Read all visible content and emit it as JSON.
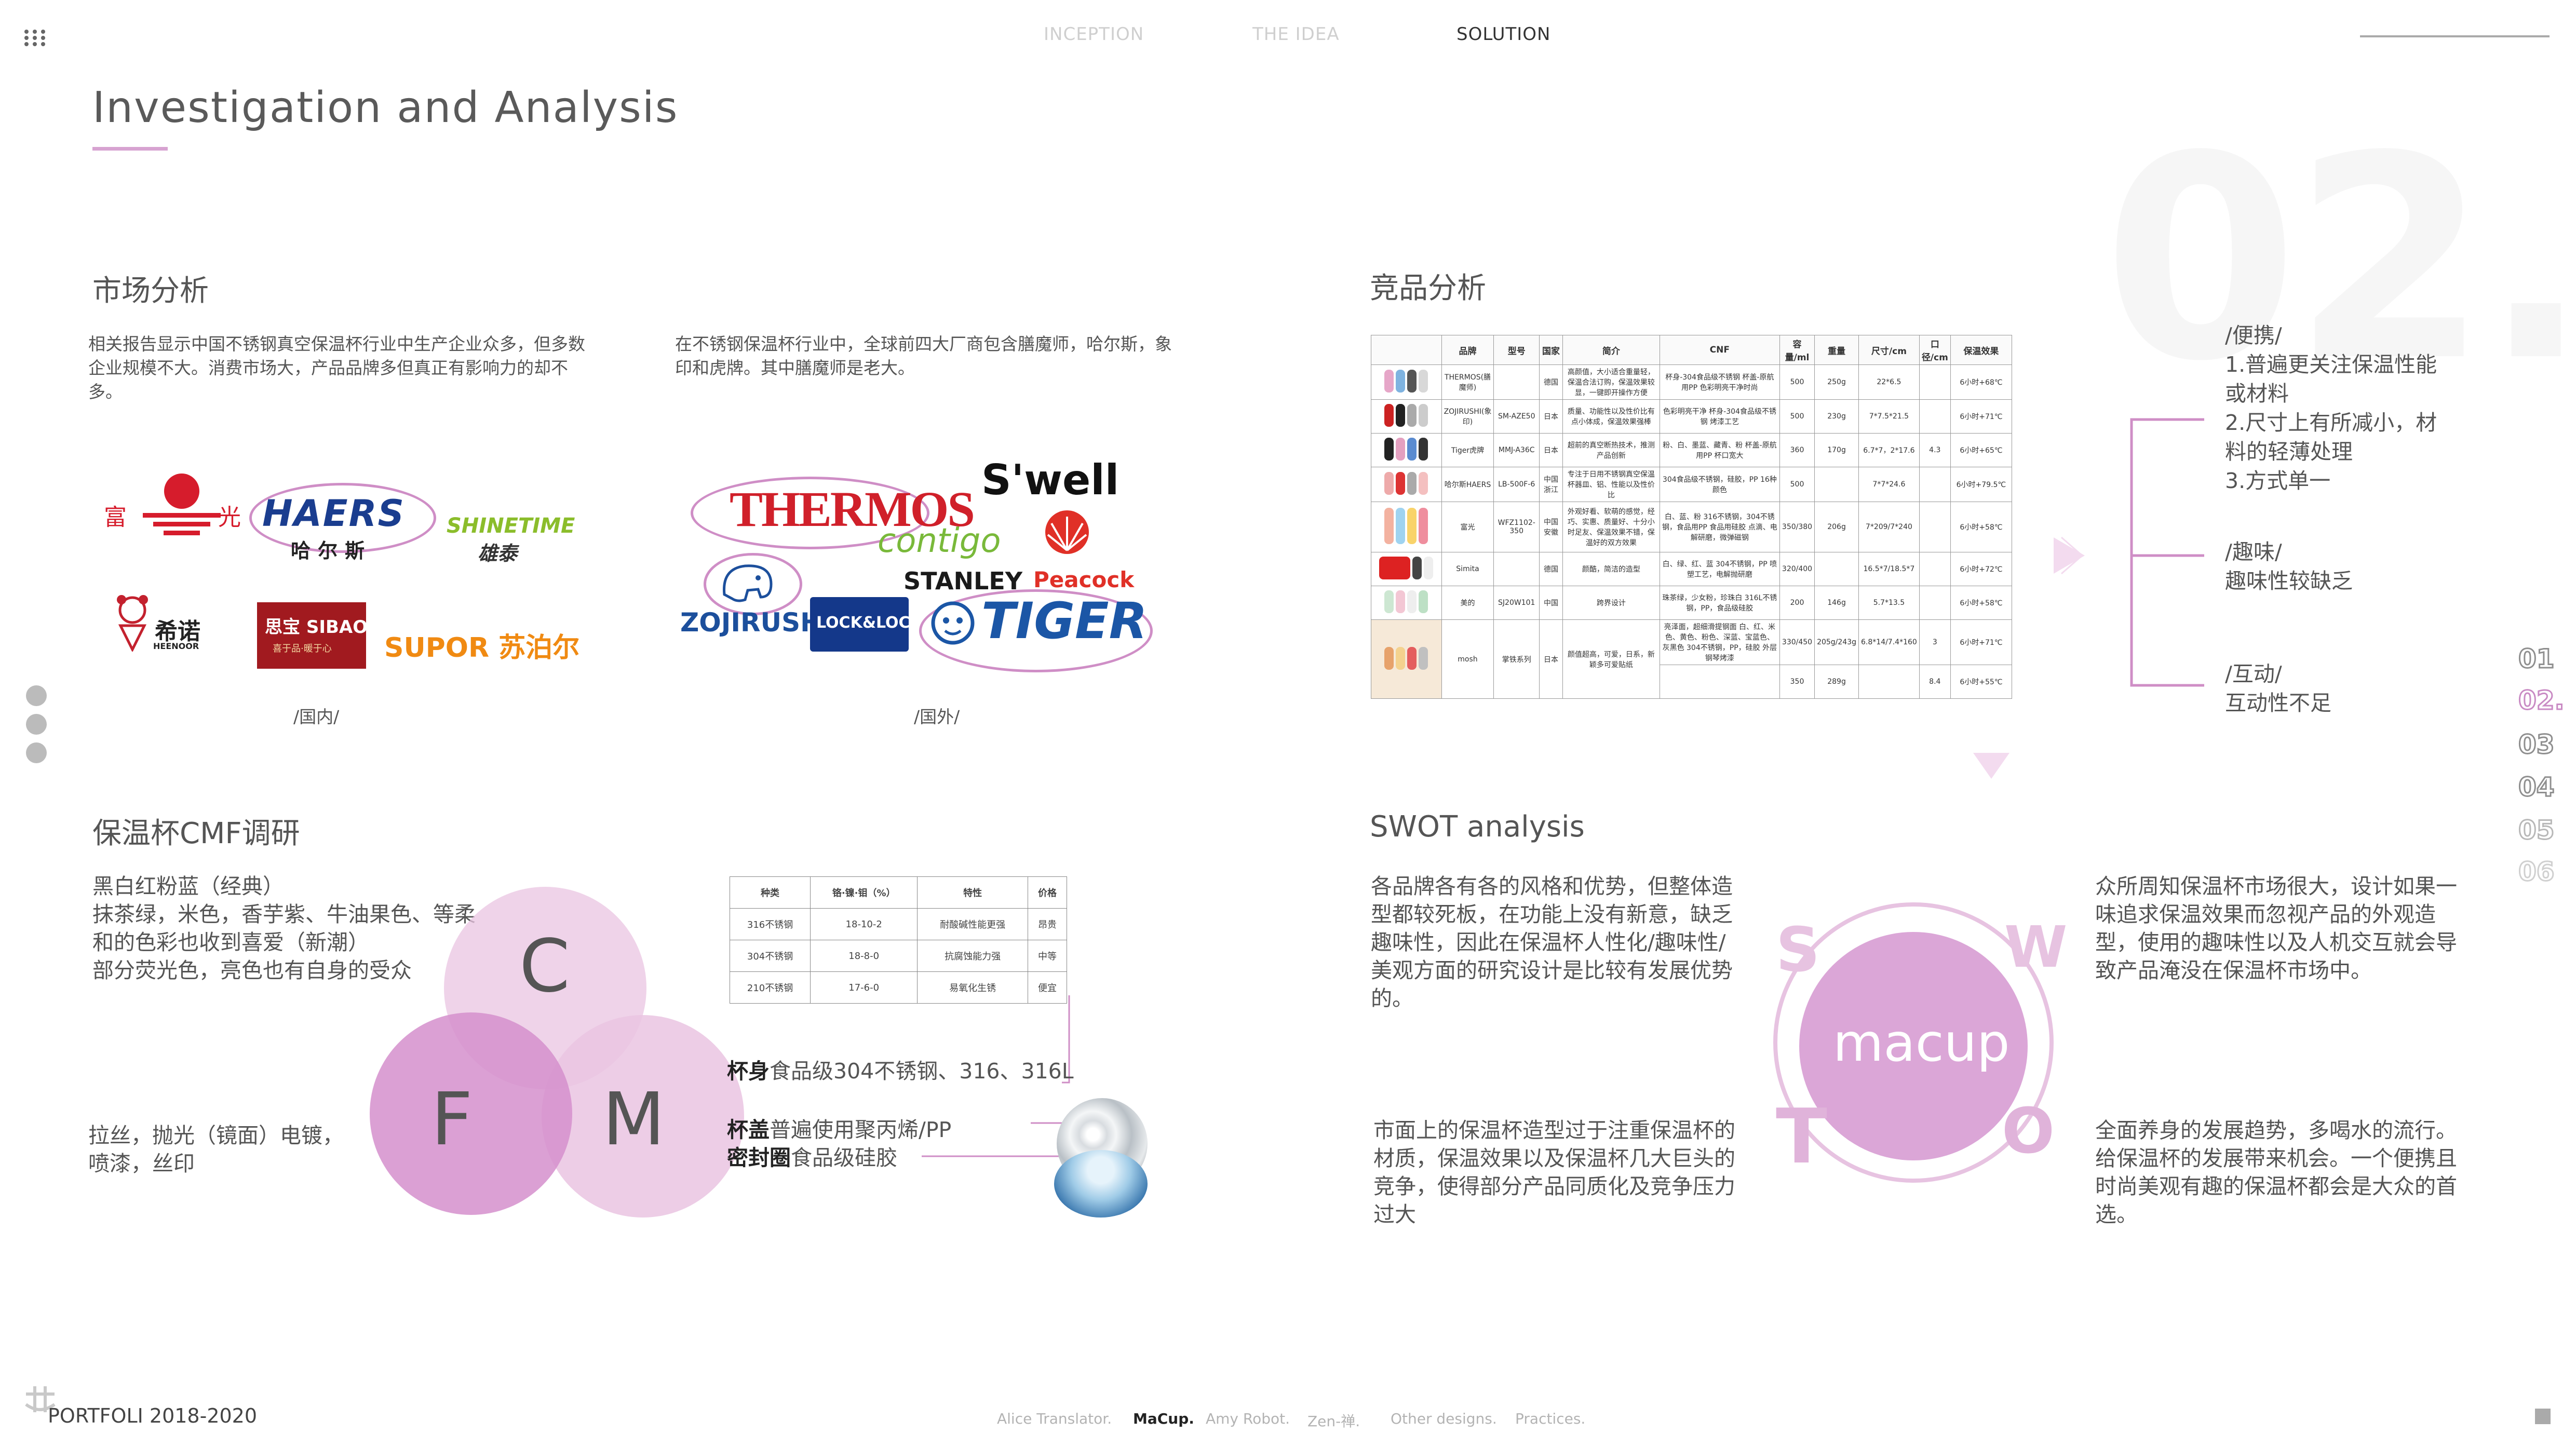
{
  "nav": {
    "tabs": [
      "INCEPTION",
      "THE IDEA",
      "SOLUTION"
    ],
    "active": "SOLUTION"
  },
  "page": {
    "title": "Investigation and Analysis",
    "big_number": "02."
  },
  "market": {
    "title": "市场分析",
    "para1": "相关报告显示中国不锈钢真空保温杯行业中生产企业众多，但多数企业规模不大。消费市场大，产品品牌多但真正有影响力的却不多。",
    "para2": "在不锈钢保温杯行业中，全球前四大厂商包含膳魔师，哈尔斯，象印和虎牌。其中膳魔师是老大。",
    "domestic_label": "/国内/",
    "foreign_label": "/国外/",
    "domestic_logos": [
      "富",
      "光",
      "HAERS",
      "哈尔斯",
      "SHINETIME",
      "雄泰",
      "希诺",
      "HEENOOR",
      "思宝 SIBAO",
      "喜于品·暖于心",
      "SUPOR 苏泊尔"
    ],
    "foreign_logos": [
      "THERMOS",
      "S'well",
      "contigo",
      "STANLEY",
      "Peacock",
      "ZOJIRUSHI",
      "LOCK&LOCK",
      "TIGER"
    ]
  },
  "competitor": {
    "title": "竞品分析",
    "headers": [
      "",
      "品牌",
      "型号",
      "国家",
      "简介",
      "CNF",
      "容量/ml",
      "重量",
      "尺寸/cm",
      "口径/cm",
      "保温效果"
    ],
    "rows": [
      [
        "THERMOS(膳魔师)",
        "",
        "德国",
        "高颜值，大小适合重量轻，保温合法订购，保温效果较显，一键即开操作方便",
        "杯身-304食品级不锈钢 杯盖-原航用PP 色彩明亮干净时尚",
        "500",
        "250g",
        "22*6.5",
        "",
        "6小时+68℃"
      ],
      [
        "ZOJIRUSHI(象印)",
        "SM-AZE50",
        "日本",
        "质量、功能性以及性价比有点小体成，保温效果强棒",
        "色彩明亮干净 杯身-304食品级不锈钢 烤漆工艺",
        "500",
        "230g",
        "7*7.5*21.5",
        "",
        "6小时+71℃"
      ],
      [
        "Tiger虎牌",
        "MMJ-A36C",
        "日本",
        "超前的真空断热技术，推测产品创新",
        "粉、白、墨蓝、藏青、粉 杯盖-原航用PP 杯口宽大",
        "360",
        "170g",
        "6.7*7，2*17.6",
        "4.3",
        "6小时+65℃"
      ],
      [
        "哈尔斯HAERS",
        "LB-500F-6",
        "中国浙江",
        "专注于日用不锈钢真空保温杯器皿、铝、性能以及性价比",
        "304食品级不锈钢，硅胶，PP 16种颜色",
        "500",
        "",
        "7*7*24.6",
        "",
        "6小时+79.5℃"
      ],
      [
        "富光",
        "WFZ1102-350",
        "中国安徽",
        "外观好看、软萌的感觉，经巧、实惠、质量好、十分小时足友、保温效果不错，保温好的双方效果",
        "白、蓝、粉 316不锈钢，304不锈钢，食品用PP 食品用硅胶 点滴、电解研磨，微弹磁钢",
        "350/380",
        "206g",
        "7*209/7*240",
        "",
        "6小时+58℃"
      ],
      [
        "Simita",
        "",
        "德国",
        "颜酷，简洁的造型",
        "白、绿、红、蓝 304不锈钢，PP 喷塑工艺，电解抛研磨",
        "320/400",
        "",
        "16.5*7/18.5*7",
        "",
        "6小时+72℃"
      ],
      [
        "美的",
        "SJ20W101",
        "中国",
        "跨界设计",
        "珠茶绿，少女粉，珍珠白 316L不锈钢，PP，食品级硅胶",
        "200",
        "146g",
        "5.7*13.5",
        "",
        "6小时+58℃"
      ],
      [
        "mosh",
        "掌铁系列",
        "日本",
        "颜值超高，可爱，日系，新颖多可爱贴纸",
        "亮泽面，超细滑提钢面 白、红、米色、黄色、粉色、深蓝、宝蓝色、灰黑色 304不锈钢，PP，硅胶 外层钢琴烤漆",
        "330/450",
        "205g/243g",
        "6.8*14/7.4*160",
        "3",
        "6小时+71℃"
      ],
      [
        "",
        "",
        "",
        "",
        "",
        "350",
        "289g",
        "",
        "8.4",
        "6小时+55℃"
      ]
    ]
  },
  "insights": {
    "block1": [
      "/便携/",
      "1.普遍更关注保温性能或材料",
      "2.尺寸上有所减小，材料的轻薄处理",
      "3.方式单一"
    ],
    "block2": [
      "/趣味/",
      "趣味性较缺乏"
    ],
    "block3": [
      "/互动/",
      "互动性不足"
    ]
  },
  "cmf": {
    "title": "保温杯CMF调研",
    "colors_text": [
      "黑白红粉蓝（经典）",
      "抹茶绿，米色，香芋紫、牛油果色、等柔和的色彩也收到喜爱（新潮）",
      "部分荧光色，亮色也有自身的受众"
    ],
    "finish_text": [
      "拉丝，抛光（镜面）电镀，",
      "喷漆，丝印"
    ],
    "circle_c": "C",
    "circle_f": "F",
    "circle_m": "M",
    "table_headers": [
      "种类",
      "铬·镍·钼（%）",
      "特性",
      "价格"
    ],
    "table_rows": [
      [
        "316不锈钢",
        "18-10-2",
        "耐酸碱性能更强",
        "昂贵"
      ],
      [
        "304不锈钢",
        "18-8-0",
        "抗腐蚀能力强",
        "中等"
      ],
      [
        "210不锈钢",
        "17-6-0",
        "易氧化生锈",
        "便宜"
      ]
    ],
    "material1": "杯身食品级304不锈钢、316、316L",
    "material1_bold": "杯身",
    "material2_line1": "杯盖普遍使用聚丙烯/PP",
    "material2_bold": "杯盖",
    "material2_line2": "密封圈食品级硅胶",
    "material3_bold": "密封圈"
  },
  "swot": {
    "title": "SWOT analysis",
    "center": "macup",
    "letters": [
      "S",
      "W",
      "T",
      "O"
    ],
    "s_text": "各品牌各有各的风格和优势，但整体造型都较死板，在功能上没有新意，缺乏趣味性，因此在保温杯人性化/趣味性/美观方面的研究设计是比较有发展优势的。",
    "w_text": "众所周知保温杯市场很大，设计如果一味追求保温效果而忽视产品的外观造型，使用的趣味性以及人机交互就会导致产品淹没在保温杯市场中。",
    "t_text": "市面上的保温杯造型过于注重保温杯的材质，保温效果以及保温杯几大巨头的竞争，使得部分产品同质化及竞争压力过大",
    "o_text": "全面养身的发展趋势，多喝水的流行。给保温杯的发展带来机会。一个便携且时尚美观有趣的保温杯都会是大众的首选。"
  },
  "side_pages": [
    "01",
    "02.",
    "03",
    "04",
    "05",
    "06"
  ],
  "footer": {
    "portfolio": "PORTFOLI 2018-2020",
    "links": [
      "Alice Translator.",
      "MaCup.",
      "Amy Robot.",
      "Zen-禅.",
      "Other designs.",
      "Practices."
    ],
    "active": "MaCup."
  },
  "colors": {
    "accent": "#c98bc4",
    "pink_light": "#f2d3ec",
    "pink_mid": "#e2a4d9",
    "nav_active": "#333333"
  }
}
